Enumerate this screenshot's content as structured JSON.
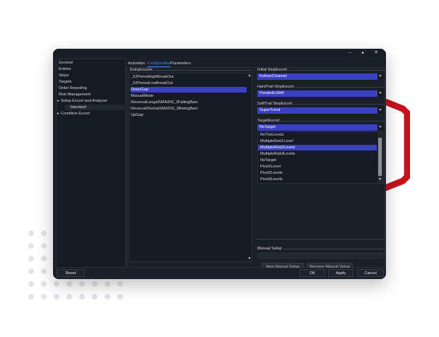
{
  "window": {
    "controls": {
      "minimize": "–",
      "maximize": "■",
      "close": "✕"
    }
  },
  "sidebar": {
    "items": [
      {
        "label": "General",
        "prefix": ""
      },
      {
        "label": "Entries",
        "prefix": ""
      },
      {
        "label": "Stops",
        "prefix": ""
      },
      {
        "label": "Targets",
        "prefix": ""
      },
      {
        "label": "Order Rounding",
        "prefix": ""
      },
      {
        "label": "Risk Management",
        "prefix": ""
      },
      {
        "label": "Setup Escort and Analyzer",
        "prefix": "▸"
      },
      {
        "label": "Standard",
        "prefix": ""
      },
      {
        "label": "Condition Escort",
        "prefix": "▸"
      }
    ]
  },
  "tabs": [
    "Activation",
    "Configuration",
    "Parameters"
  ],
  "entry_escorts": {
    "label": "EntryEscorts",
    "items": [
      "_52PeriodHighBreakOut",
      "_52PeriodLowBreakOut",
      "DownGap",
      "ManualMode",
      "ReversalLongatSMA200_3FallingBars",
      "ReversalShortatSMA200_3RisingBars",
      "UpGap"
    ],
    "selected_index": 2
  },
  "initial_stop": {
    "label": "Initial StopEscort",
    "value": "KeltnerChannel"
  },
  "hard_trail": {
    "label": "HardTrail StopEscort",
    "value": "ParabolicSAR"
  },
  "soft_trail": {
    "label": "SoftTrail StopEscort",
    "value": "SuperTrend"
  },
  "target_escort": {
    "label": "TargetEscort",
    "value": "NoTarget",
    "options": [
      "ReTickLevels",
      "MultipleRisk1Level",
      "MultipleRisk2Levels",
      "MultipleRisk3Levels",
      "NoTarget",
      "Pivot1Level",
      "Pivot2Levels",
      "Pivot3Levels"
    ],
    "highlighted_index": 2
  },
  "manual_setup": {
    "label": "Manual Setup",
    "new_label": "New Manual Setup",
    "remove_label": "Remove Manual Setup"
  },
  "footer": {
    "reset_label": "Reset",
    "ok_label": "OK",
    "apply_label": "Apply",
    "cancel_label": "Cancel"
  },
  "colors": {
    "accent": "#3b3fc2",
    "tab_active": "#4b8bd8",
    "bracket": "#c8121b"
  }
}
